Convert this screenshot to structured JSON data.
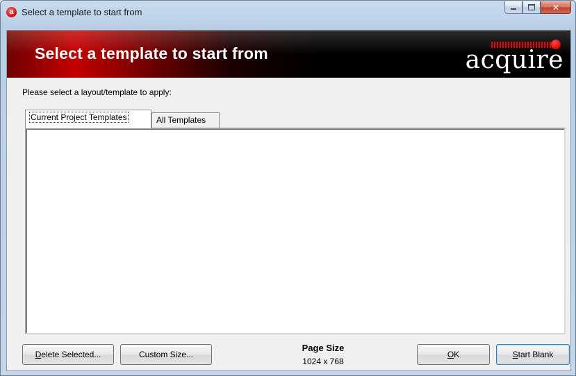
{
  "window": {
    "title": "Select a template to start from",
    "icon": "acquire-app-icon",
    "icon_letter": "a",
    "controls": [
      "minimize-icon",
      "maximize-icon",
      "close-icon"
    ]
  },
  "banner": {
    "title": "Select a template to start from",
    "brand": "acquire",
    "brand_color": "#e00000"
  },
  "prompt": "Please select a layout/template to apply:",
  "tabs": [
    {
      "label": "Current Project Templates",
      "selected": true
    },
    {
      "label": "All Templates",
      "selected": false
    }
  ],
  "templates": [],
  "footer": {
    "delete_button": {
      "pre": "",
      "u": "D",
      "post": "elete Selected..."
    },
    "custom_size_button": "Custom Size...",
    "page_size_label": "Page Size",
    "page_size_value": "1024 x 768",
    "ok_button": {
      "pre": "",
      "u": "O",
      "post": "K"
    },
    "start_blank_button": {
      "pre": "",
      "u": "S",
      "post": "tart Blank"
    }
  },
  "colors": {
    "banner_red": "#c40000",
    "banner_black": "#000000",
    "default_button_border": "#3c7fb1"
  }
}
